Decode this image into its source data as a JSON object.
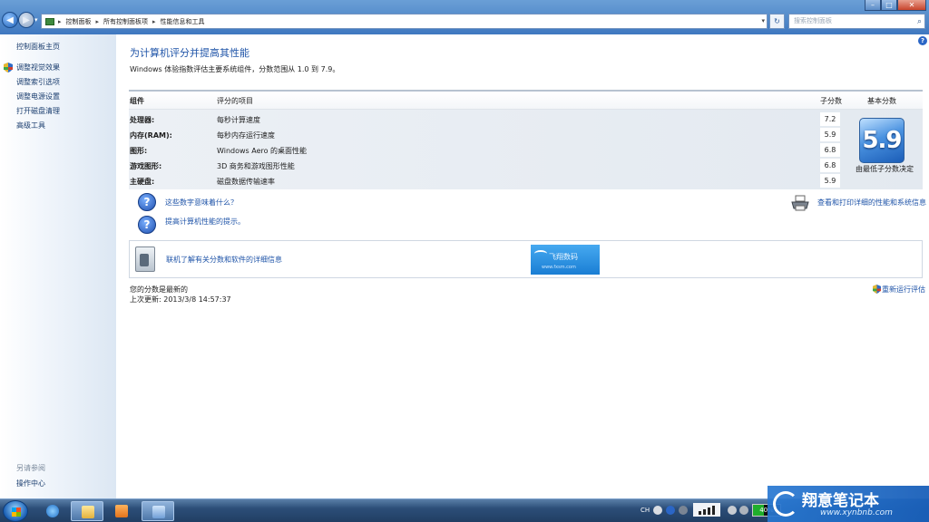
{
  "address_bar": {
    "breadcrumbs": [
      "控制面板",
      "所有控制面板项",
      "性能信息和工具"
    ],
    "search_placeholder": "搜索控制面板"
  },
  "sidebar": {
    "links": [
      "控制面板主页",
      "调整视觉效果",
      "调整索引选项",
      "调整电源设置",
      "打开磁盘清理",
      "高级工具"
    ],
    "see_also_heading": "另请参阅",
    "see_also_links": [
      "操作中心"
    ]
  },
  "main": {
    "title": "为计算机评分并提高其性能",
    "subtitle": "Windows 体验指数评估主要系统组件，分数范围从 1.0 到 7.9。",
    "table": {
      "headers": {
        "component": "组件",
        "rated_item": "评分的项目",
        "subscore": "子分数",
        "base_score": "基本分数"
      },
      "rows": [
        {
          "component": "处理器:",
          "item": "每秒计算速度",
          "score": "7.2"
        },
        {
          "component": "内存(RAM):",
          "item": "每秒内存运行速度",
          "score": "5.9"
        },
        {
          "component": "图形:",
          "item": "Windows Aero 的桌面性能",
          "score": "6.8"
        },
        {
          "component": "游戏图形:",
          "item": "3D 商务和游戏图形性能",
          "score": "6.8"
        },
        {
          "component": "主硬盘:",
          "item": "磁盘数据传输速率",
          "score": "5.9"
        }
      ],
      "base_score": "5.9",
      "base_caption": "由最低子分数决定"
    },
    "help_links": [
      "这些数字意味着什么？",
      "提高计算机性能的提示。"
    ],
    "print_link": "查看和打印详细的性能和系统信息",
    "online_link": "联机了解有关分数和软件的详细信息",
    "watermark": {
      "title": "飞翔数码",
      "url": "www.fxsm.com"
    },
    "status": "您的分数是最新的",
    "last_update": "上次更新: 2013/3/8 14:57:37",
    "rerun_link": "重新运行评估"
  },
  "taskbar": {
    "lang": "CH",
    "battery": "40%"
  },
  "brand": {
    "title": "翔意笔记本",
    "url": "www.xynbnb.com"
  }
}
